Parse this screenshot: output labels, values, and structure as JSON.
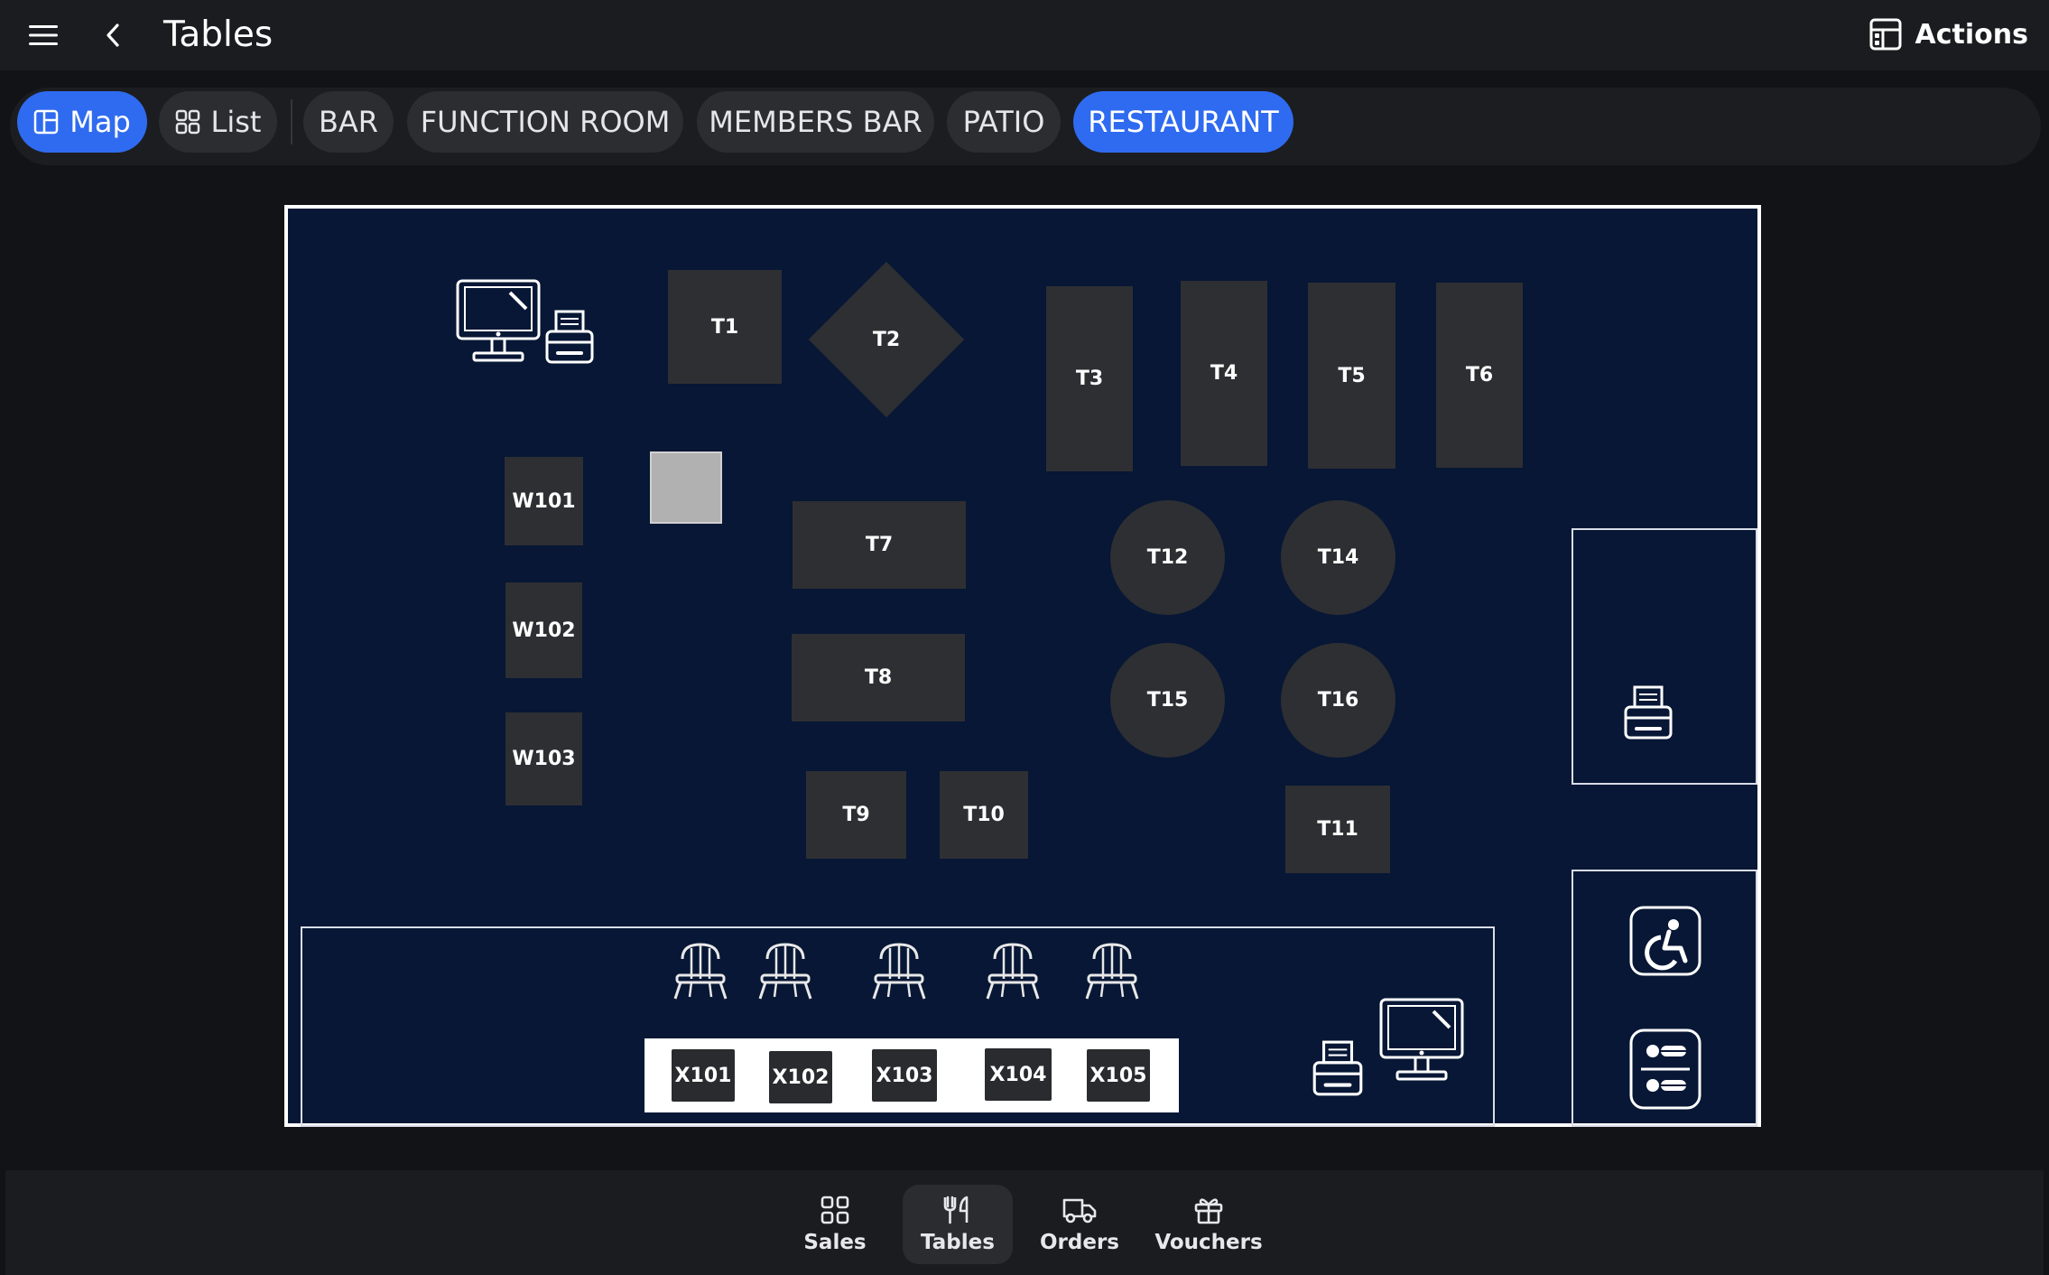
{
  "header": {
    "menu_icon": "hamburger-menu-icon",
    "back_icon": "chevron-left-icon",
    "title": "Tables",
    "actions_label": "Actions",
    "actions_icon": "layout-dashboard-icon"
  },
  "view_toggle": {
    "map_label": "Map",
    "list_label": "List"
  },
  "areas": [
    "BAR",
    "FUNCTION ROOM",
    "MEMBERS BAR",
    "PATIO",
    "RESTAURANT"
  ],
  "selected_area": "RESTAURANT",
  "floor_plan": {
    "tables": {
      "t1": "T1",
      "t2": "T2",
      "t3": "T3",
      "t4": "T4",
      "t5": "T5",
      "t6": "T6",
      "t7": "T7",
      "t8": "T8",
      "t9": "T9",
      "t10": "T10",
      "t11": "T11",
      "t12": "T12",
      "t14": "T14",
      "t15": "T15",
      "t16": "T16",
      "w101": "W101",
      "w102": "W102",
      "w103": "W103",
      "x101": "X101",
      "x102": "X102",
      "x103": "X103",
      "x104": "X104",
      "x105": "X105"
    },
    "icons": [
      "computer-monitor-icon",
      "receipt-printer-icon",
      "bar-stool-icon",
      "accessible-toilet-icon",
      "restroom-icon"
    ]
  },
  "bottom_nav": {
    "items": [
      {
        "label": "Sales",
        "icon": "grid-icon"
      },
      {
        "label": "Tables",
        "icon": "utensils-icon"
      },
      {
        "label": "Orders",
        "icon": "delivery-truck-icon"
      },
      {
        "label": "Vouchers",
        "icon": "gift-icon"
      }
    ],
    "active": "Tables"
  },
  "colors": {
    "accent": "#2f6bf0",
    "background": "#121316",
    "map_background": "#071735",
    "table_fill": "#2e2f33"
  }
}
